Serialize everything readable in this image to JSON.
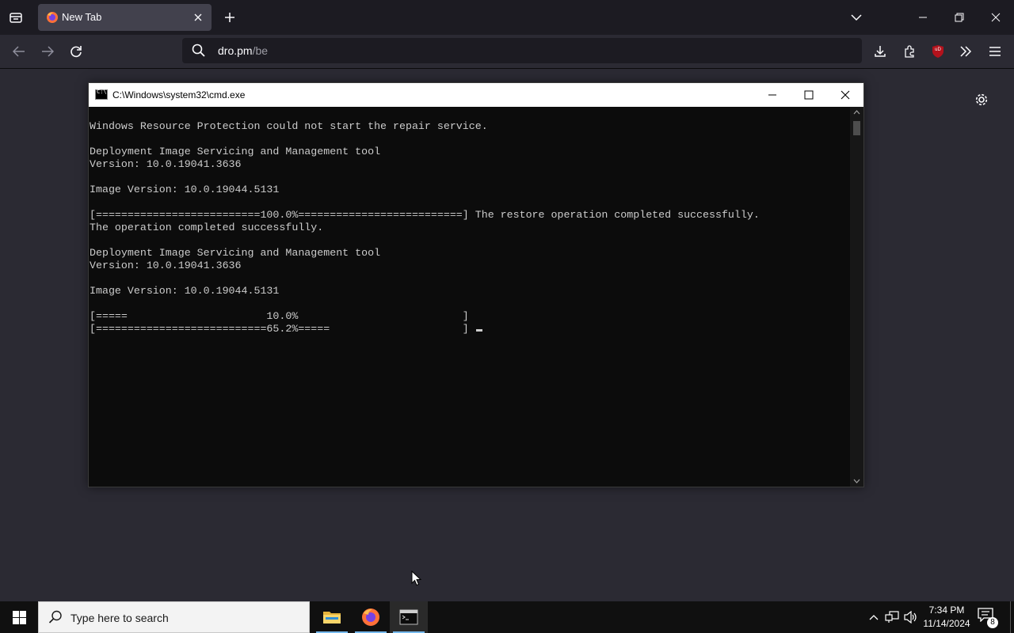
{
  "browser": {
    "tab": {
      "title": "New Tab"
    },
    "url": {
      "host": "dro.pm",
      "path": "/be"
    },
    "ublock_badge": "uD"
  },
  "cmd": {
    "title": "C:\\Windows\\system32\\cmd.exe",
    "lines": [
      "Windows Resource Protection could not start the repair service.",
      "",
      "Deployment Image Servicing and Management tool",
      "Version: 10.0.19041.3636",
      "",
      "Image Version: 10.0.19044.5131",
      "",
      "[==========================100.0%==========================] The restore operation completed successfully.",
      "The operation completed successfully.",
      "",
      "Deployment Image Servicing and Management tool",
      "Version: 10.0.19041.3636",
      "",
      "Image Version: 10.0.19044.5131",
      "",
      "[=====                      10.0%                          ]",
      "[===========================65.2%=====                     ] "
    ]
  },
  "taskbar": {
    "search_placeholder": "Type here to search",
    "clock_time": "7:34 PM",
    "clock_date": "11/14/2024",
    "notification_count": "8"
  },
  "colors": {
    "browser_bg": "#2b2a33",
    "tabstrip_bg": "#1c1b22",
    "console_bg": "#0c0c0c",
    "console_text": "#cccccc",
    "taskbar_bg": "#101010",
    "ublock_red": "#b3121c"
  }
}
